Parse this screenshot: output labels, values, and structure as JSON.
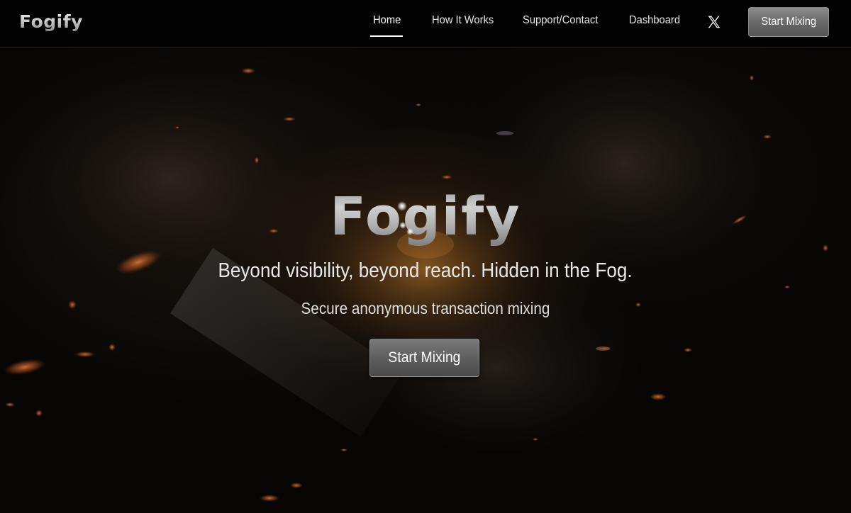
{
  "nav": {
    "logo": "Fogify",
    "links": [
      {
        "label": "Home",
        "active": true
      },
      {
        "label": "How It Works",
        "active": false
      },
      {
        "label": "Support/Contact",
        "active": false
      },
      {
        "label": "Dashboard",
        "active": false
      }
    ],
    "social_icon": "x-icon",
    "cta_label": "Start Mixing"
  },
  "hero": {
    "title": "Fogify",
    "tagline": "Beyond visibility, beyond reach. Hidden in the Fog.",
    "subtitle": "Secure anonymous transaction mixing",
    "cta_label": "Start Mixing"
  },
  "colors": {
    "background": "#070605",
    "ember": "#c2602a",
    "text": "#e8e8e8",
    "button": "#6a6a6a"
  }
}
